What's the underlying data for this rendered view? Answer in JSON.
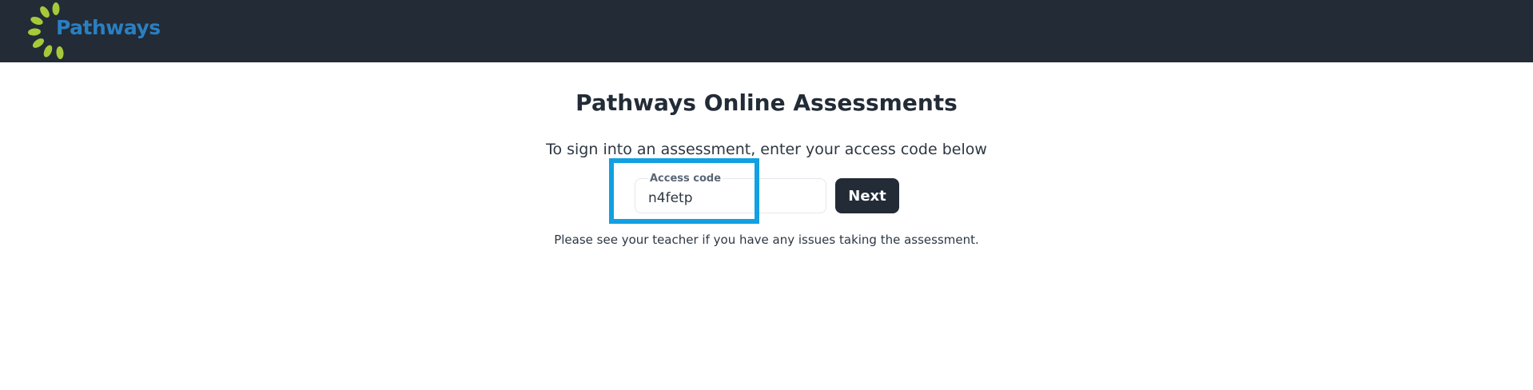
{
  "header": {
    "logo_text": "Pathways",
    "logo_icon": "sunburst-logo-icon",
    "bg_color": "#222b36",
    "logo_text_color": "#2a7fc1",
    "logo_mark_color": "#a6c93a"
  },
  "main": {
    "title": "Pathways Online Assessments",
    "subtitle": "To sign into an assessment, enter your access code below",
    "access_code": {
      "label": "Access code",
      "value": "n4fetp"
    },
    "next_label": "Next",
    "help_text": "Please see your teacher if you have any issues taking the assessment.",
    "highlight_color": "#12a0e2"
  }
}
